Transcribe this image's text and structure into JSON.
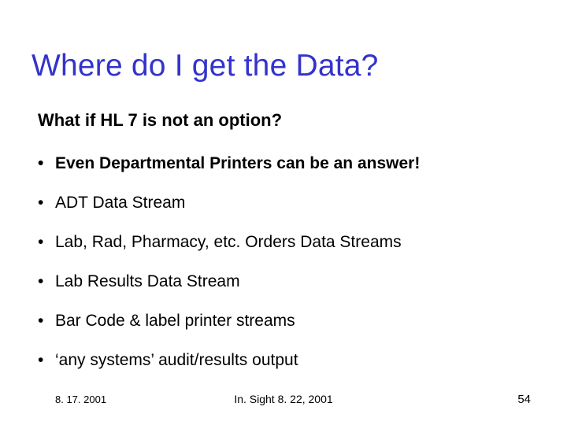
{
  "title": "Where do I get the Data?",
  "subtitle": "What if HL 7 is not an option?",
  "bullets": [
    "Even Departmental Printers can be an answer!",
    "ADT Data Stream",
    "Lab, Rad, Pharmacy, etc. Orders Data Streams",
    "Lab Results Data Stream",
    "Bar Code & label printer streams",
    "‘any systems’ audit/results output"
  ],
  "footer": {
    "left": "8. 17. 2001",
    "center": "In. Sight 8. 22, 2001",
    "right": "54"
  }
}
